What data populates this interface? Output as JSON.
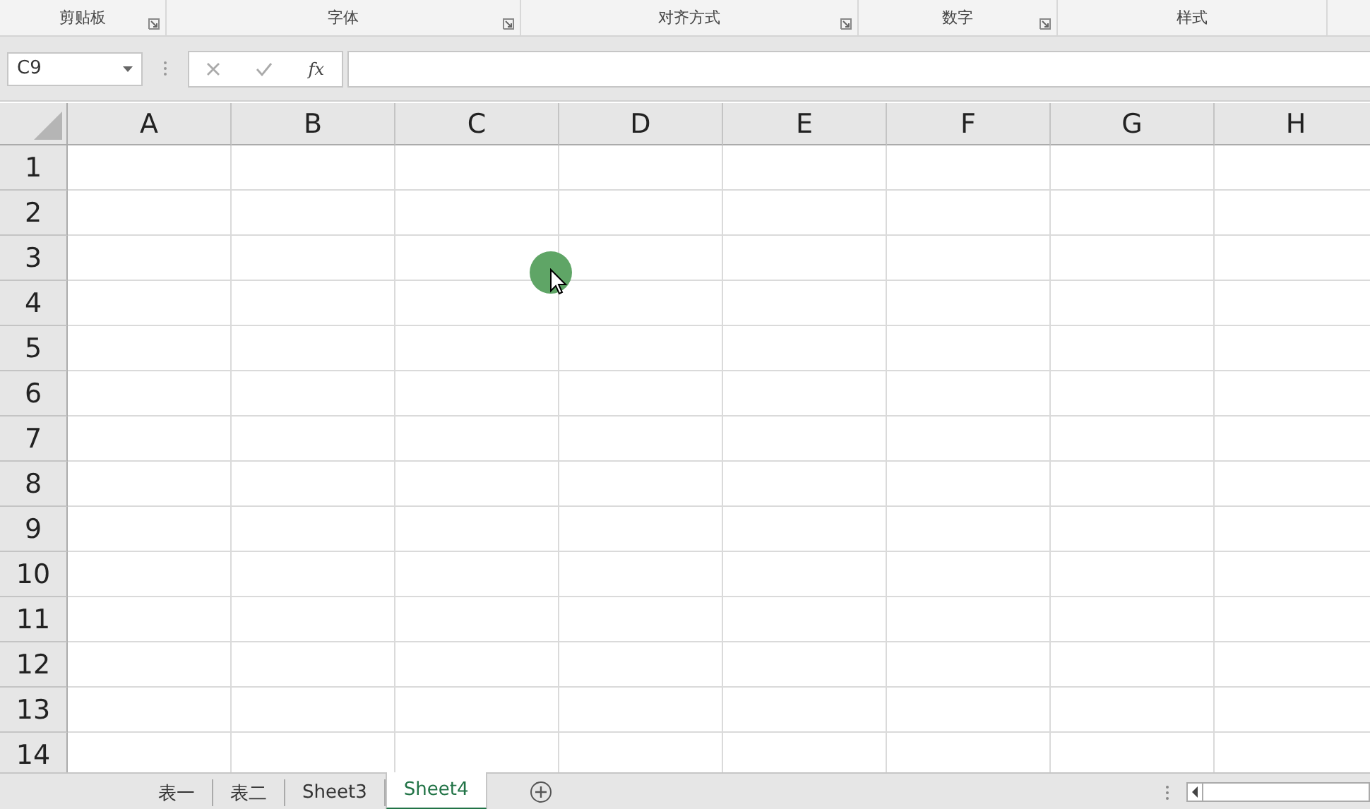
{
  "ribbon_groups": [
    {
      "label": "剪贴板",
      "launcher": true
    },
    {
      "label": "字体",
      "launcher": true
    },
    {
      "label": "对齐方式",
      "launcher": true
    },
    {
      "label": "数字",
      "launcher": true
    },
    {
      "label": "样式",
      "launcher": false
    }
  ],
  "formula_bar": {
    "name_box": "C9",
    "function_button": "fx"
  },
  "columns": [
    "A",
    "B",
    "C",
    "D",
    "E",
    "F",
    "G",
    "H"
  ],
  "rows": [
    "1",
    "2",
    "3",
    "4",
    "5",
    "6",
    "7",
    "8",
    "9",
    "10",
    "11",
    "12",
    "13",
    "14"
  ],
  "sheet_tabs": [
    {
      "label": "表一",
      "selected": false
    },
    {
      "label": "表二",
      "selected": false
    },
    {
      "label": "Sheet3",
      "selected": false
    },
    {
      "label": "Sheet4",
      "selected": true
    }
  ]
}
